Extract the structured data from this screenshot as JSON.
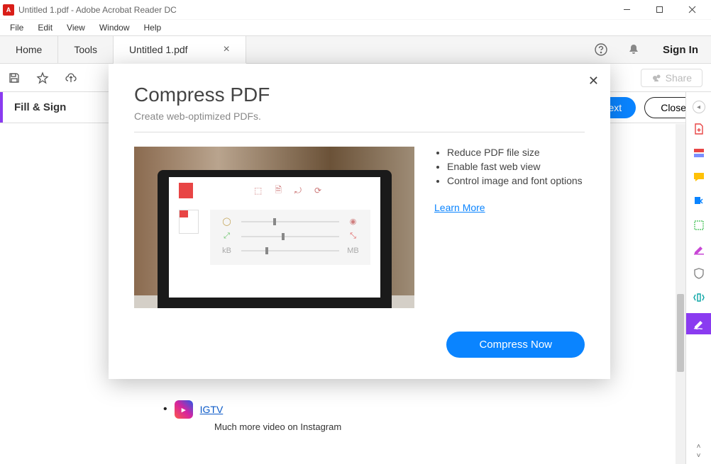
{
  "window": {
    "title": "Untitled 1.pdf - Adobe Acrobat Reader DC"
  },
  "menu": {
    "items": [
      "File",
      "Edit",
      "View",
      "Window",
      "Help"
    ]
  },
  "nav": {
    "home": "Home",
    "tools": "Tools",
    "doc_tab": "Untitled 1.pdf",
    "sign_in": "Sign In"
  },
  "toolbar": {
    "share": "Share"
  },
  "fillsign": {
    "label": "Fill & Sign",
    "next": "ext",
    "close": "Close"
  },
  "document": {
    "link_text": "IGTV",
    "subtext": "Much more video on Instagram"
  },
  "laptop_preview": {
    "rows": [
      {
        "left_icon": "circles",
        "right_icon": "rgb-circles",
        "handle_pos": "33%"
      },
      {
        "left_icon": "expand-green",
        "right_icon": "expand-red",
        "handle_pos": "42%"
      },
      {
        "left_label": "kB",
        "right_label": "MB",
        "handle_pos": "25%"
      }
    ]
  },
  "modal": {
    "title": "Compress PDF",
    "subtitle": "Create web-optimized PDFs.",
    "bullets": [
      "Reduce PDF file size",
      "Enable fast web view",
      "Control image and font options"
    ],
    "learn_more": "Learn More",
    "cta": "Compress Now"
  }
}
